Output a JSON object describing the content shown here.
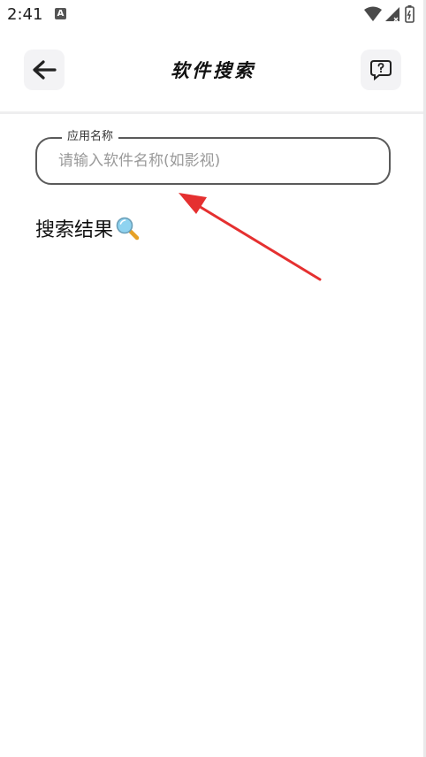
{
  "status_bar": {
    "time": "2:41",
    "notification_letter": "A"
  },
  "header": {
    "title": "软件搜索"
  },
  "search_field": {
    "label": "应用名称",
    "placeholder": "请输入软件名称(如影视)",
    "value": ""
  },
  "results": {
    "heading": "搜索结果"
  },
  "icons": {
    "back": "arrow-left-icon",
    "help": "question-bubble-icon",
    "wifi": "wifi-icon",
    "signal": "signal-icon",
    "battery": "battery-icon",
    "magnifier": "magnifier-icon"
  },
  "colors": {
    "field_border": "#5a5a5a",
    "button_bg": "#f3f3f5",
    "annotation_arrow": "#e53030",
    "magnifier_lens": "#8fd3f0",
    "magnifier_handle": "#e6a126"
  }
}
